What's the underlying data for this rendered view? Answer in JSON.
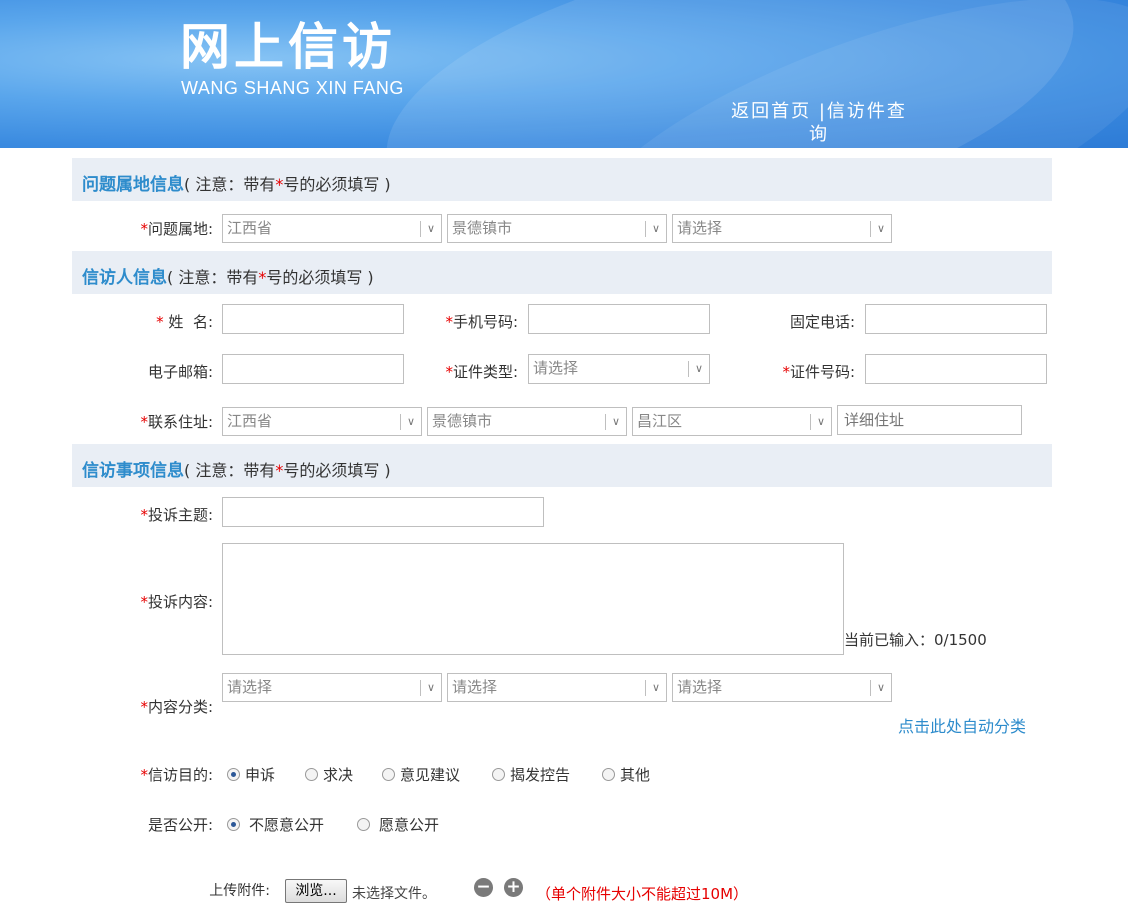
{
  "header": {
    "title": "网上信访",
    "subtitle": "WANG SHANG XIN FANG",
    "link_home": "返回首页",
    "separator": "|",
    "link_query": "信访件查询"
  },
  "sections": {
    "location": {
      "title": "问题属地信息",
      "note_prefix": "( 注意：带有",
      "note_star": "*",
      "note_suffix": "号的必须填写 )"
    },
    "petitioner": {
      "title": "信访人信息",
      "note_prefix": "( 注意：带有",
      "note_star": "*",
      "note_suffix": "号的必须填写 )"
    },
    "matter": {
      "title": "信访事项信息",
      "note_prefix": "( 注意：带有",
      "note_star": "*",
      "note_suffix": "号的必须填写 )"
    }
  },
  "required_mark": "*",
  "location": {
    "label": "问题属地:",
    "province": "江西省",
    "city": "景德镇市",
    "district": "请选择"
  },
  "petitioner": {
    "name_label": " 姓  名:",
    "name_value": "",
    "mobile_label": "手机号码:",
    "mobile_value": "",
    "phone_label": "固定电话:",
    "phone_value": "",
    "email_label": "电子邮箱:",
    "email_value": "",
    "id_type_label": "证件类型:",
    "id_type_value": "请选择",
    "id_no_label": "证件号码:",
    "id_no_value": "",
    "address_label": "联系住址:",
    "address_province": "江西省",
    "address_city": "景德镇市",
    "address_district": "昌江区",
    "address_detail_placeholder": "详细住址"
  },
  "matter": {
    "subject_label": "投诉主题:",
    "subject_value": "",
    "content_label": "投诉内容:",
    "content_value": "",
    "counter": "当前已输入：0/1500",
    "category_label": "内容分类:",
    "category_1": "请选择",
    "category_2": "请选择",
    "category_3": "请选择",
    "auto_classify": "点击此处自动分类",
    "purpose_label": "信访目的:",
    "purpose_options": [
      "申诉",
      "求决",
      "意见建议",
      "揭发控告",
      "其他"
    ],
    "purpose_selected": "申诉",
    "public_label": "是否公开:",
    "public_options": [
      "不愿意公开",
      "愿意公开"
    ],
    "public_selected": "不愿意公开",
    "attach_label": "上传附件:",
    "browse_label": "浏览...",
    "no_file": "未选择文件。",
    "remove_symbol": "−",
    "add_symbol": "+",
    "attach_note": "（单个附件大小不能超过10M）"
  },
  "colors": {
    "accent": "#2e8ccc",
    "required": "#e60000",
    "section_bg": "#e9eef5",
    "banner": "#3b8be0"
  }
}
